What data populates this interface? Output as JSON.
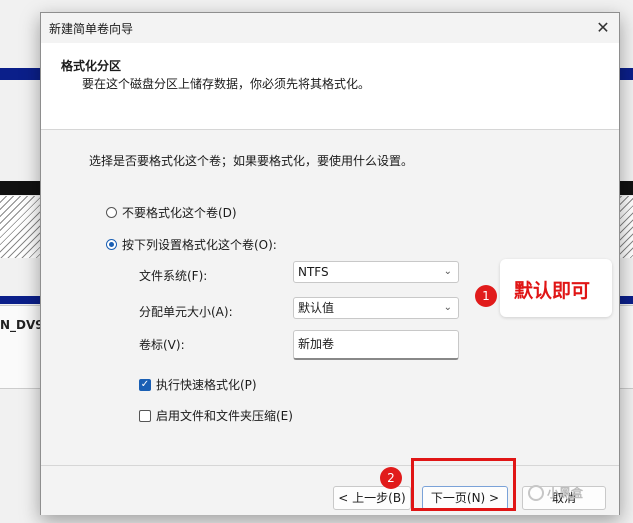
{
  "background": {
    "volume_label": "N_DV9"
  },
  "dialog": {
    "title": "新建简单卷向导",
    "close_symbol": "✕",
    "header_title": "格式化分区",
    "header_subtitle": "要在这个磁盘分区上储存数据，你必须先将其格式化。",
    "intro": "选择是否要格式化这个卷；如果要格式化，要使用什么设置。",
    "options": {
      "no_format": "不要格式化这个卷(D)",
      "format": "按下列设置格式化这个卷(O):"
    },
    "fields": {
      "filesystem_label": "文件系统(F):",
      "filesystem_value": "NTFS",
      "allocation_label": "分配单元大小(A):",
      "allocation_value": "默认值",
      "volume_label_label": "卷标(V):",
      "volume_label_value": "新加卷"
    },
    "checkboxes": {
      "quick_format": "执行快速格式化(P)",
      "compression": "启用文件和文件夹压缩(E)"
    },
    "buttons": {
      "back": "< 上一步(B)",
      "next": "下一页(N) >",
      "cancel": "取消"
    }
  },
  "annotations": {
    "step1_number": "1",
    "step1_text": "默认即可",
    "step2_number": "2"
  },
  "watermark": "小黑盒",
  "colors": {
    "accent": "#1a5fb4",
    "annotation_red": "#e01515"
  },
  "icons": {
    "close": "close-icon",
    "chevron": "chevron-down-icon",
    "check": "checkmark-icon",
    "watermark": "heybox-logo-icon"
  }
}
